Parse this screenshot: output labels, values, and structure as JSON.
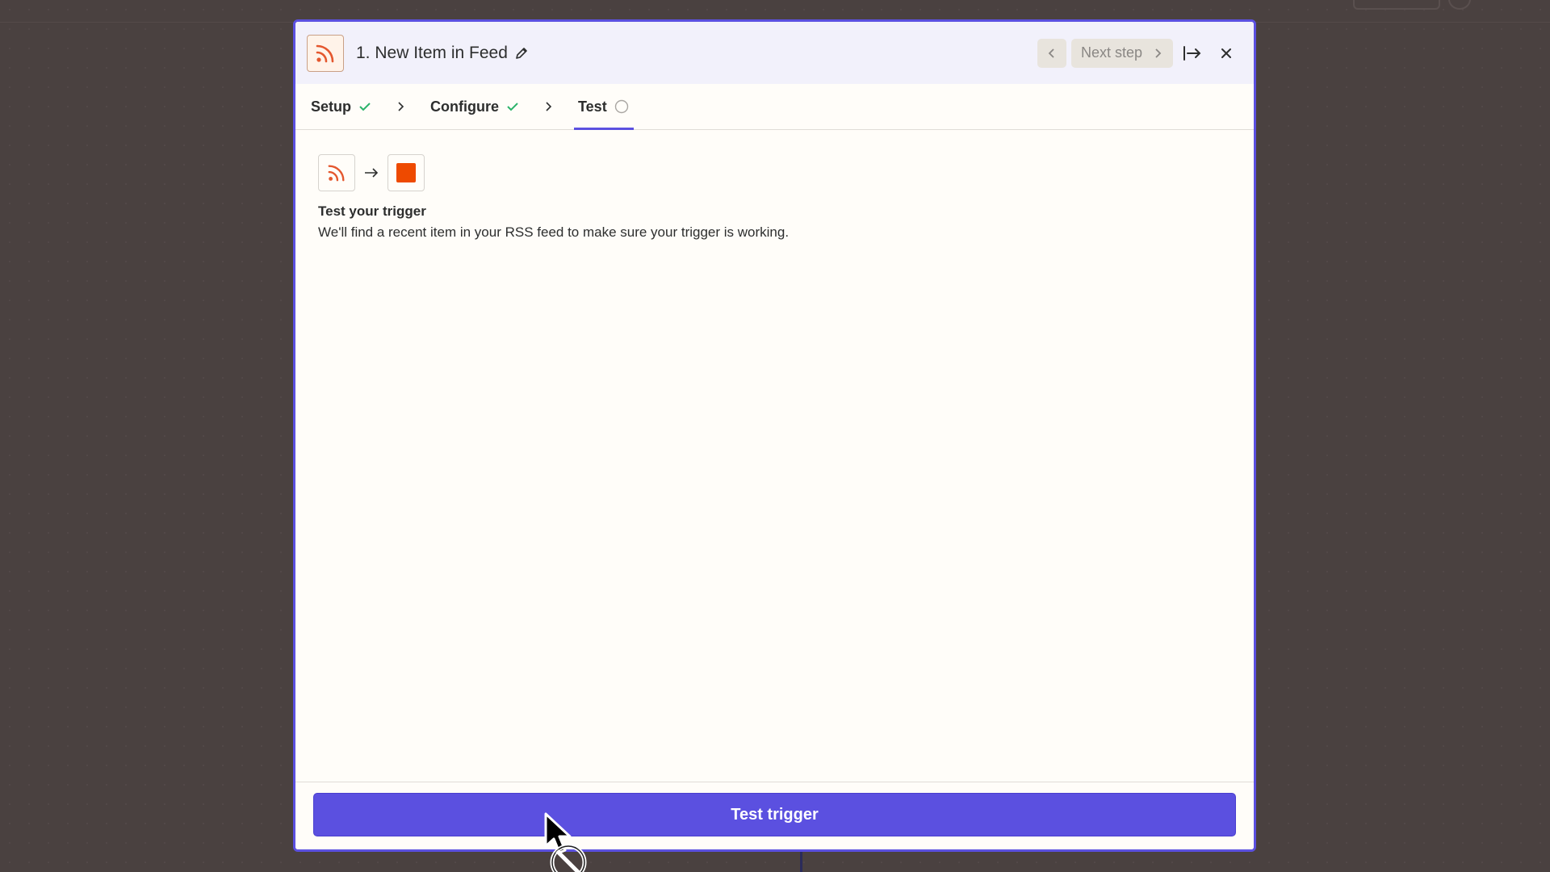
{
  "header": {
    "step_title": "1. New Item in Feed",
    "next_label": "Next step"
  },
  "tabs": [
    {
      "label": "Setup",
      "status": "complete"
    },
    {
      "label": "Configure",
      "status": "complete"
    },
    {
      "label": "Test",
      "status": "pending"
    }
  ],
  "content": {
    "title": "Test your trigger",
    "description": "We'll find a recent item in your RSS feed to make sure your trigger is working."
  },
  "footer": {
    "button_label": "Test trigger"
  },
  "colors": {
    "accent": "#5b50e0",
    "rss": "#e4572e",
    "app_orange": "#ee4a00",
    "success": "#2bb36b"
  }
}
